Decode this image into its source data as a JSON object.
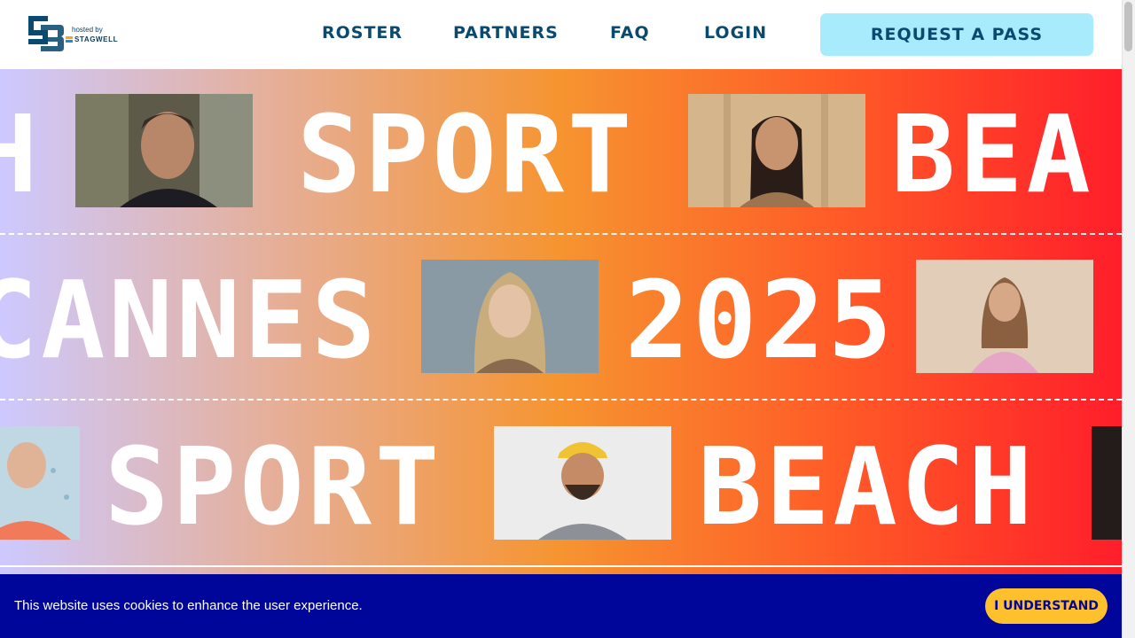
{
  "brand": {
    "logo_text": "SB",
    "hosted_by": "hosted by",
    "host_name": "STAGWELL"
  },
  "nav": {
    "items": [
      "ROSTER",
      "PARTNERS",
      "FAQ",
      "LOGIN"
    ],
    "cta": "REQUEST A PASS"
  },
  "hero": {
    "row1": {
      "words": [
        "H",
        "SPORT",
        "BEA"
      ]
    },
    "row2": {
      "words": [
        "CANNES",
        "2025"
      ]
    },
    "row3": {
      "words": [
        "SPORT",
        "BEACH"
      ]
    }
  },
  "cookie_banner": {
    "message": "This website uses cookies to enhance the user experience.",
    "button": "I UNDERSTAND"
  },
  "colors": {
    "nav_text": "#0b4a70",
    "cta_bg": "#a7ebfc",
    "cookie_bg": "#01069b",
    "cookie_button": "#ffc02e"
  }
}
